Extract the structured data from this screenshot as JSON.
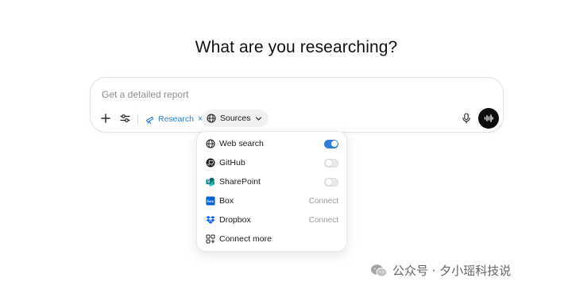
{
  "heading": "What are you researching?",
  "composer": {
    "placeholder": "Get a detailed report",
    "add_icon": "plus-icon",
    "tools_icon": "sliders-icon",
    "research_label": "Research",
    "research_remove": "×",
    "sources_label": "Sources",
    "mic_icon": "microphone-icon",
    "voice_icon": "voice-waveform-icon"
  },
  "sources_menu": {
    "items": [
      {
        "label": "Web search",
        "icon": "globe-icon",
        "control": "toggle",
        "enabled": true
      },
      {
        "label": "GitHub",
        "icon": "github-icon",
        "control": "toggle",
        "enabled": false
      },
      {
        "label": "SharePoint",
        "icon": "sharepoint-icon",
        "control": "toggle",
        "enabled": false
      },
      {
        "label": "Box",
        "icon": "box-icon",
        "control": "connect",
        "action_label": "Connect"
      },
      {
        "label": "Dropbox",
        "icon": "dropbox-icon",
        "control": "connect",
        "action_label": "Connect"
      },
      {
        "label": "Connect more",
        "icon": "apps-grid-icon",
        "control": "none"
      }
    ]
  },
  "watermark": "公众号 · 夕小瑶科技说",
  "colors": {
    "accent": "#2f7fd6",
    "voice_button": "#0d0d0d",
    "sharepoint": "#0b7a75",
    "box": "#0061d5",
    "dropbox": "#0061fe"
  }
}
